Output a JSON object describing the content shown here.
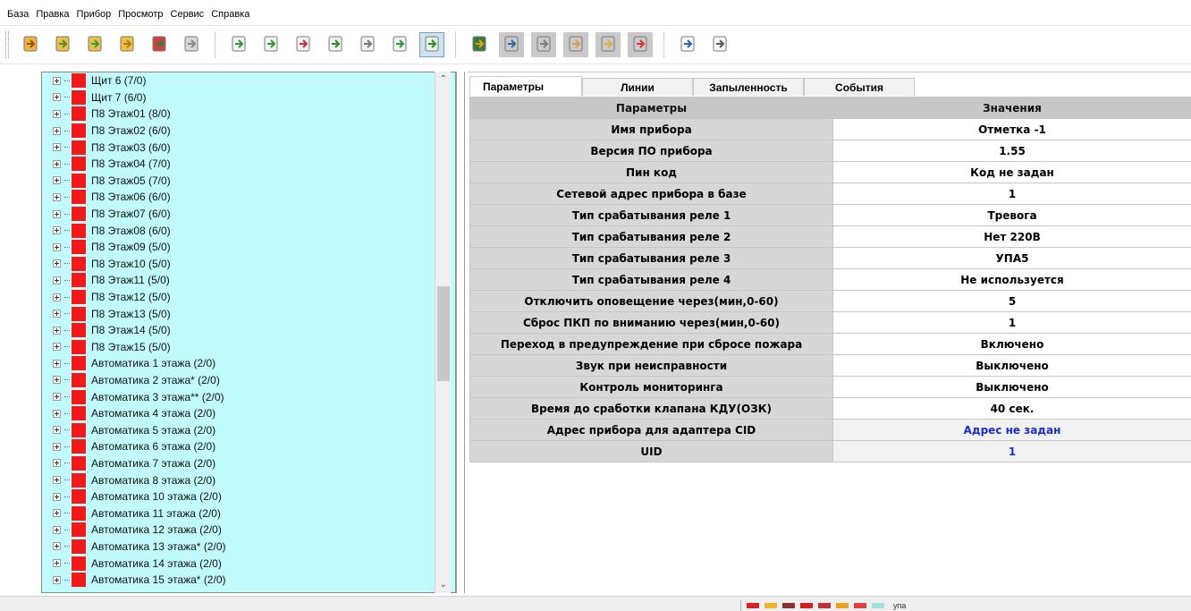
{
  "menu": [
    "База",
    "Правка",
    "Прибор",
    "Просмотр",
    "Сервис",
    "Справка"
  ],
  "toolbar": {
    "icons": [
      "database-open-icon",
      "folder-open-icon",
      "folder-import-icon",
      "tree-structure-icon",
      "add-device-icon",
      "cylinder-icon",
      "doc-import-icon",
      "doc-export-icon",
      "doc-arrow-icon",
      "doc-check-icon",
      "doc-plain-icon",
      "doc-arrow2-icon",
      "refresh-icon",
      "tree-add-icon",
      "cut-icon",
      "copy-icon",
      "paste-icon",
      "paste2-icon",
      "delete-icon",
      "undo-icon",
      "binoculars-icon"
    ]
  },
  "tree": {
    "items": [
      "Щит 6 (7/0)",
      "Щит 7 (6/0)",
      "П8 Этаж01 (8/0)",
      "П8 Этаж02 (6/0)",
      "П8 Этаж03 (6/0)",
      "П8 Этаж04 (7/0)",
      "П8 Этаж05 (7/0)",
      "П8 Этаж06 (6/0)",
      "П8 Этаж07 (6/0)",
      "П8 Этаж08 (6/0)",
      "П8 Этаж09 (5/0)",
      "П8 Этаж10 (5/0)",
      "П8 Этаж11 (5/0)",
      "П8 Этаж12 (5/0)",
      "П8 Этаж13 (5/0)",
      "П8 Этаж14 (5/0)",
      "П8 Этаж15 (5/0)",
      "Автоматика 1 этажа (2/0)",
      "Автоматика 2 этажа* (2/0)",
      "Автоматика 3 этажа** (2/0)",
      "Автоматика 4 этажа (2/0)",
      "Автоматика 5 этажа (2/0)",
      "Автоматика 6 этажа (2/0)",
      "Автоматика 7 этажа (2/0)",
      "Автоматика 8 этажа (2/0)",
      "Автоматика 10 этажа (2/0)",
      "Автоматика 11 этажа (2/0)",
      "Автоматика 12 этажа (2/0)",
      "Автоматика 13 этажа* (2/0)",
      "Автоматика 14 этажа (2/0)",
      "Автоматика 15 этажа* (2/0)"
    ]
  },
  "tabs": [
    "Параметры",
    "Линии",
    "Запыленность",
    "События"
  ],
  "table": {
    "headers": [
      "Параметры",
      "Значения"
    ],
    "rows": [
      [
        "Имя прибора",
        "Отметка -1"
      ],
      [
        "Версия ПО прибора",
        "1.55"
      ],
      [
        "Пин код",
        "Код не задан"
      ],
      [
        "Сетевой адрес прибора в базе",
        "1"
      ],
      [
        "Тип срабатывания реле 1",
        "Тревога"
      ],
      [
        "Тип срабатывания реле 2",
        "Нет 220В"
      ],
      [
        "Тип срабатывания реле 3",
        "УПА5"
      ],
      [
        "Тип срабатывания реле 4",
        "Не используется"
      ],
      [
        "Отключить оповещение через(мин,0-60)",
        "5"
      ],
      [
        "Сброс ПКП по вниманию через(мин,0-60)",
        "1"
      ],
      [
        "Переход в предупреждение при сбросе пожара",
        "Включено"
      ],
      [
        "Звук при неисправности",
        "Выключено"
      ],
      [
        "Контроль мониторинга",
        "Выключено"
      ],
      [
        "Время до сработки клапана КДУ(ОЗК)",
        "40 сек."
      ],
      [
        "Адрес прибора для адаптера CID",
        "Адрес не задан"
      ],
      [
        "UID",
        "1"
      ]
    ]
  },
  "status": {
    "legend_colors": [
      "#e02020",
      "#f0b030",
      "#8a3030",
      "#d02020",
      "#c03030",
      "#f0a020",
      "#e04040",
      "#a0e0e0"
    ],
    "legend_text": "упа"
  }
}
